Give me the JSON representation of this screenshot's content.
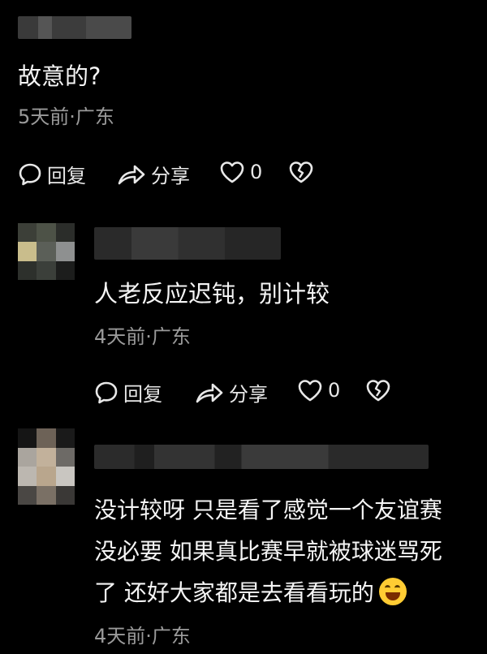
{
  "comments": [
    {
      "text": "故意的?",
      "meta": "5天前·广东",
      "actions": {
        "reply": "回复",
        "share": "分享",
        "like_count": "0"
      }
    },
    {
      "text": "人老反应迟钝，别计较",
      "meta": "4天前·广东",
      "actions": {
        "reply": "回复",
        "share": "分享",
        "like_count": "0"
      }
    },
    {
      "lines": [
        "没计较呀 只是看了感觉一个友谊赛",
        "没必要 如果真比赛早就被球迷骂死",
        "了 还好大家都是去看看玩的"
      ],
      "meta": "4天前·广东"
    }
  ],
  "icons": [
    "comment-icon",
    "share-icon",
    "heart-icon",
    "broken-heart-icon",
    "laughing-emoji"
  ],
  "colors": {
    "background": "#000000",
    "text": "#f5f5f5",
    "meta": "#9a9a9a"
  }
}
